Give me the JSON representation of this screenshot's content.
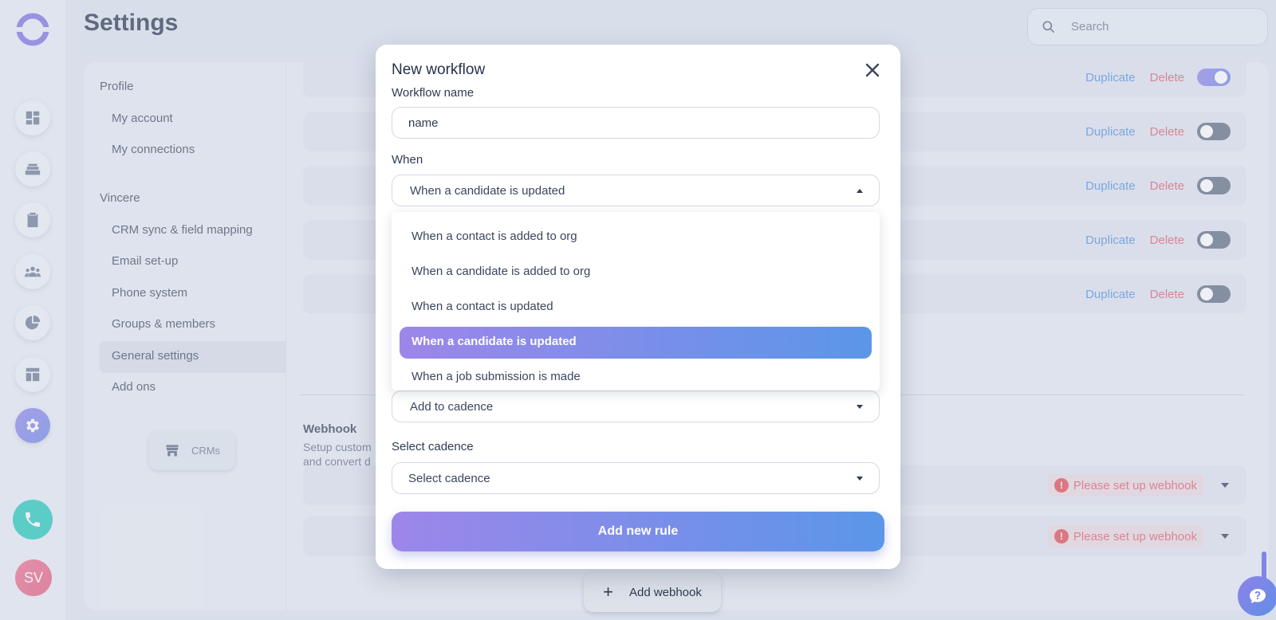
{
  "header": {
    "title": "Settings",
    "search_placeholder": "Search"
  },
  "rail": {
    "avatar_initials": "SV",
    "icons": [
      "logo-icon",
      "dashboard-icon",
      "inbox-icon",
      "clipboard-icon",
      "team-icon",
      "pie-chart-icon",
      "layout-icon",
      "gear-icon",
      "phone-icon"
    ]
  },
  "settings_nav": {
    "groups": [
      {
        "label": "Profile",
        "items": [
          "My account",
          "My connections"
        ]
      },
      {
        "label": "Vincere",
        "items": [
          "CRM sync & field mapping",
          "Email set-up",
          "Phone system",
          "Groups & members",
          "General settings",
          "Add ons"
        ]
      }
    ],
    "active_item": "General settings",
    "crms_label": "CRMs"
  },
  "workflow_rows": {
    "duplicate_label": "Duplicate",
    "delete_label": "Delete",
    "toggles": [
      true,
      false,
      false,
      false,
      false
    ]
  },
  "webhook": {
    "title": "Webhook",
    "desc_line1": "Setup custom",
    "desc_line2": "and convert d",
    "warning": "Please set up webhook",
    "add_label": "Add webhook"
  },
  "modal": {
    "title": "New workflow",
    "name_label": "Workflow name",
    "name_value": "name",
    "when_label": "When",
    "when_value": "When a candidate is updated",
    "when_options": [
      "When a contact is added to org",
      "When a candidate is added to org",
      "When a contact is updated",
      "When a candidate is updated",
      "When a job submission is made"
    ],
    "selected_index": 3,
    "action_value": "Add to cadence",
    "cadence_label": "Select cadence",
    "cadence_placeholder": "Select cadence",
    "submit_label": "Add new rule"
  },
  "colors": {
    "accent_start": "#9d86ea",
    "accent_end": "#5b96e8",
    "danger": "#e25a6a",
    "link": "#4f8fd8",
    "phone": "#1fc8b9"
  }
}
